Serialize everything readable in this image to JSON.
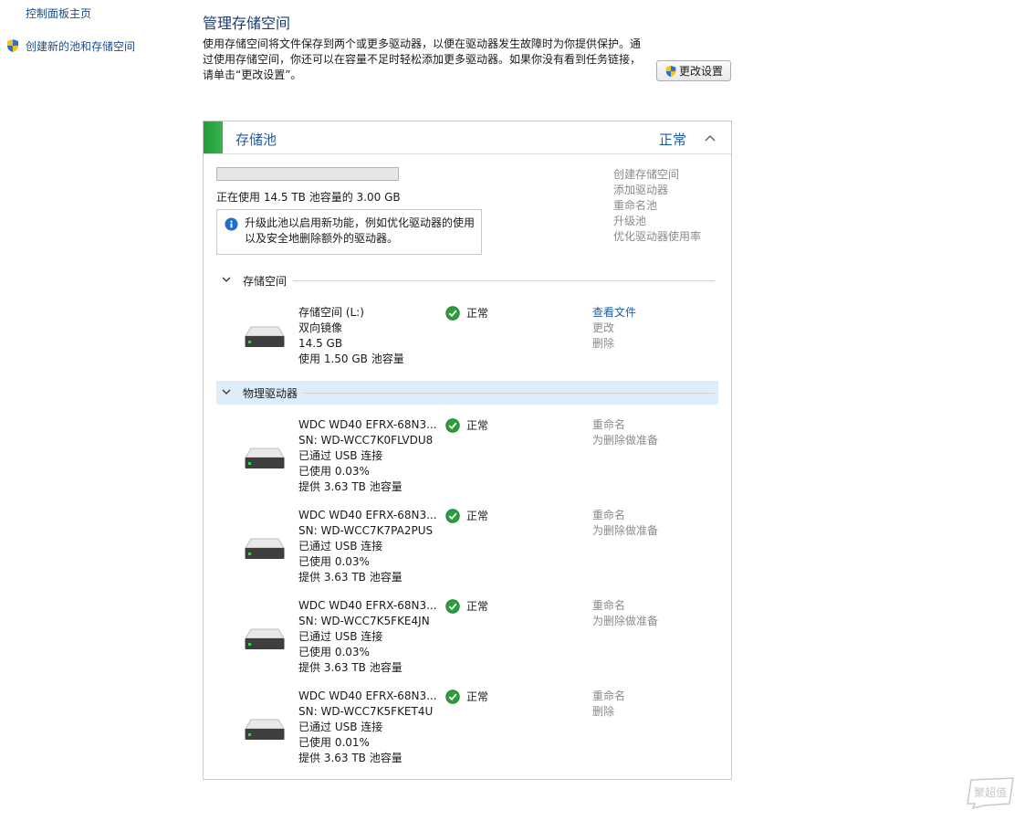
{
  "nav": {
    "home": "控制面板主页",
    "create_pool": "创建新的池和存储空间"
  },
  "header": {
    "title": "管理存储空间",
    "description": "使用存储空间将文件保存到两个或更多驱动器，以便在驱动器发生故障时为你提供保护。通过使用存储空间，你还可以在容量不足时轻松添加更多驱动器。如果你没有看到任务链接，请单击“更改设置”。",
    "change_settings": "更改设置"
  },
  "pool": {
    "title": "存储池",
    "status": "正常",
    "usage_fraction": 0.0002,
    "usage_text": "正在使用 14.5 TB 池容量的 3.00 GB",
    "info": "升级此池以启用新功能，例如优化驱动器的使用以及安全地删除额外的驱动器。",
    "actions": [
      "创建存储空间",
      "添加驱动器",
      "重命名池",
      "升级池",
      "优化驱动器使用率"
    ]
  },
  "spaces_section": {
    "label": "存储空间",
    "items": [
      {
        "lines": [
          "存储空间 (L:)",
          "双向镜像",
          "14.5 GB",
          "使用 1.50 GB 池容量"
        ],
        "status": "正常",
        "actions": [
          "查看文件",
          "更改",
          "删除"
        ]
      }
    ]
  },
  "drives_section": {
    "label": "物理驱动器",
    "items": [
      {
        "lines": [
          "WDC WD40 EFRX-68N3...",
          "SN: WD-WCC7K0FLVDU8",
          "已通过 USB 连接",
          "已使用 0.03%",
          "提供 3.63 TB 池容量"
        ],
        "status": "正常",
        "actions": [
          "重命名",
          "为删除做准备"
        ]
      },
      {
        "lines": [
          "WDC WD40 EFRX-68N3...",
          "SN: WD-WCC7K7PA2PUS",
          "已通过 USB 连接",
          "已使用 0.03%",
          "提供 3.63 TB 池容量"
        ],
        "status": "正常",
        "actions": [
          "重命名",
          "为删除做准备"
        ]
      },
      {
        "lines": [
          "WDC WD40 EFRX-68N3...",
          "SN: WD-WCC7K5FKE4JN",
          "已通过 USB 连接",
          "已使用 0.03%",
          "提供 3.63 TB 池容量"
        ],
        "status": "正常",
        "actions": [
          "重命名",
          "为删除做准备"
        ]
      },
      {
        "lines": [
          "WDC WD40 EFRX-68N3...",
          "SN: WD-WCC7K5FKET4U",
          "已通过 USB 连接",
          "已使用 0.01%",
          "提供 3.63 TB 池容量"
        ],
        "status": "正常",
        "actions": [
          "重命名",
          "删除"
        ]
      }
    ]
  },
  "watermark": "聚超值",
  "colors": {
    "link": "#1f5b9c",
    "pool_green": "#1f9d3a",
    "section_highlight": "#ddeefa",
    "disabled_action": "#8a8a8a"
  }
}
